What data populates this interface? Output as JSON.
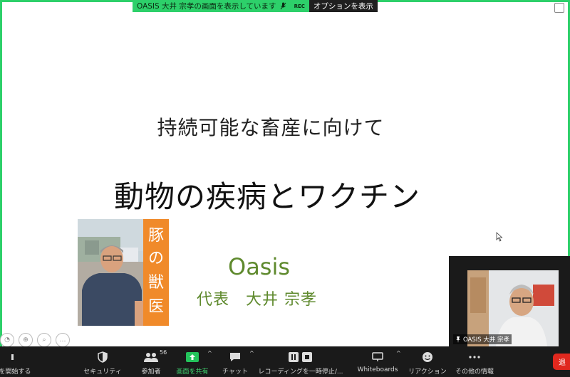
{
  "share_banner": {
    "status_text": "OASIS 大井 宗孝の画面を表示しています",
    "rec_label": "REC",
    "options_button": "オプションを表示"
  },
  "slide": {
    "subtitle": "持続可能な畜産に向けて",
    "title": "動物の疾病とワクチン",
    "organization": "Oasis",
    "presenter": "代表　大井 宗孝",
    "photo_banner_text": "豚の獣医"
  },
  "self_video": {
    "name_label": "OASIS 大井 宗孝"
  },
  "toolbar": {
    "start_video": "を開始する",
    "security": "セキュリティ",
    "participants": "参加者",
    "participants_count": "56",
    "share_screen": "画面を共有",
    "chat": "チャット",
    "recording": "レコーディングを一時停止/...",
    "whiteboards": "Whiteboards",
    "reactions": "リアクション",
    "more": "その他の情報",
    "end": "退"
  },
  "colors": {
    "share_green": "#2dd06a",
    "slide_green": "#5f8a2e",
    "toolbar_bg": "#1a1a1a",
    "end_red": "#e0281e"
  }
}
